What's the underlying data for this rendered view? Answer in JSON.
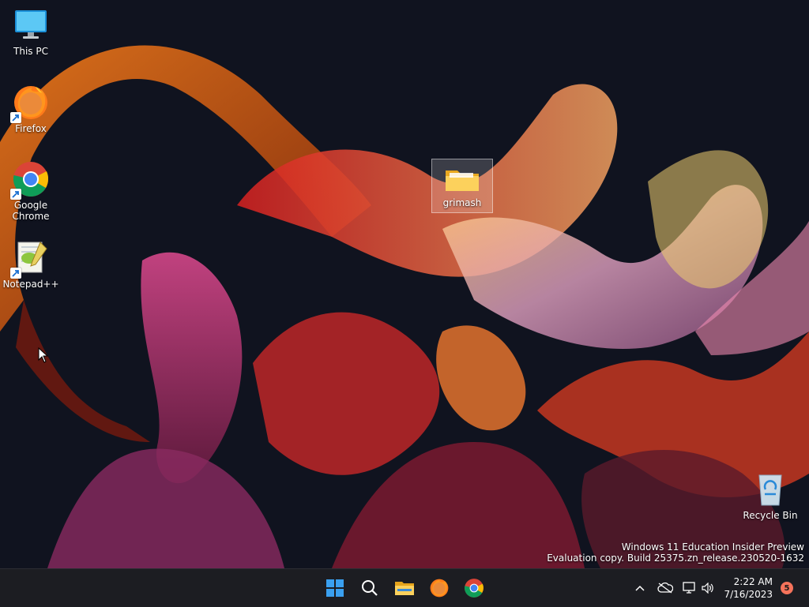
{
  "desktop": {
    "icons": [
      {
        "label": "This PC",
        "icon": "monitor-icon"
      },
      {
        "label": "Firefox",
        "icon": "firefox-icon"
      },
      {
        "label": "Google Chrome",
        "icon": "chrome-icon"
      },
      {
        "label": "Notepad++",
        "icon": "notepad-plus-plus-icon"
      },
      {
        "label": "grimash",
        "icon": "folder-icon"
      },
      {
        "label": "Recycle Bin",
        "icon": "recycle-bin-icon"
      }
    ],
    "watermark": {
      "line1": "Windows 11 Education Insider Preview",
      "line2": "Evaluation copy. Build 25375.zn_release.230520-1632"
    }
  },
  "taskbar": {
    "apps": [
      "start-icon",
      "search-icon",
      "file-explorer-icon",
      "firefox-icon",
      "chrome-icon"
    ],
    "tray": {
      "time": "2:22 AM",
      "date": "7/16/2023",
      "notification_count": "5"
    }
  },
  "colors": {
    "taskbar_bg": "#1c1d22",
    "desktop_bg": "#0f1220",
    "badge": "#f5735b",
    "win_blue": "#3aa0f0"
  }
}
